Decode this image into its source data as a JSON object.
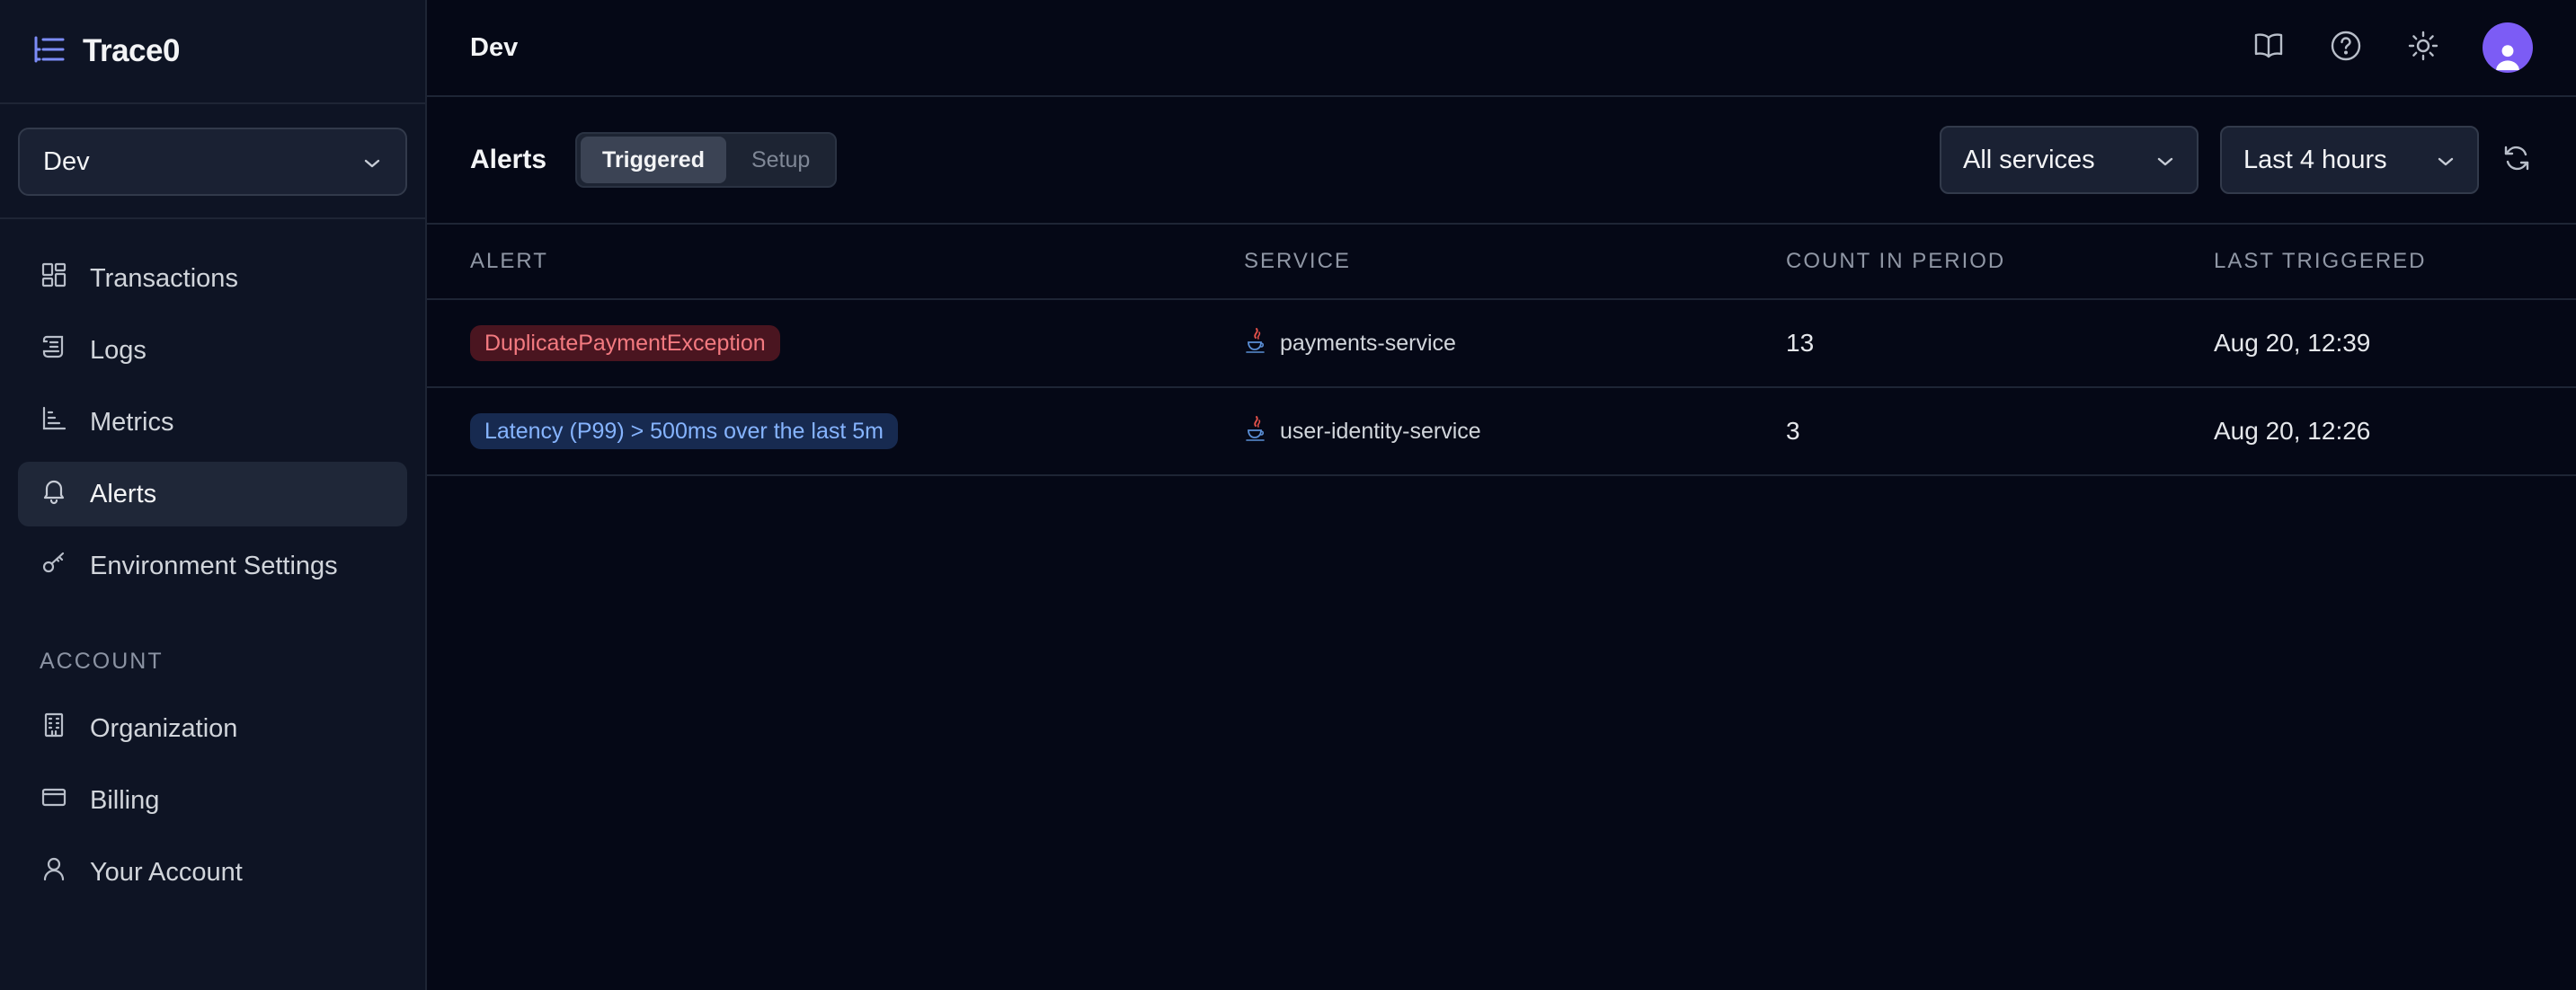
{
  "app": {
    "name": "Trace0"
  },
  "sidebar": {
    "environment": "Dev",
    "nav": [
      {
        "label": "Transactions",
        "icon": "dashboard-icon",
        "active": false
      },
      {
        "label": "Logs",
        "icon": "scroll-icon",
        "active": false
      },
      {
        "label": "Metrics",
        "icon": "bar-chart-icon",
        "active": false
      },
      {
        "label": "Alerts",
        "icon": "bell-icon",
        "active": true
      },
      {
        "label": "Environment Settings",
        "icon": "key-icon",
        "active": false
      }
    ],
    "account_section_label": "ACCOUNT",
    "account": [
      {
        "label": "Organization",
        "icon": "building-icon"
      },
      {
        "label": "Billing",
        "icon": "credit-card-icon"
      },
      {
        "label": "Your Account",
        "icon": "user-icon"
      }
    ]
  },
  "header": {
    "title": "Dev"
  },
  "toolbar": {
    "title": "Alerts",
    "tabs": [
      {
        "label": "Triggered",
        "active": true
      },
      {
        "label": "Setup",
        "active": false
      }
    ],
    "service_filter": "All services",
    "time_range": "Last 4 hours"
  },
  "table": {
    "columns": [
      "ALERT",
      "SERVICE",
      "COUNT IN PERIOD",
      "LAST TRIGGERED"
    ],
    "rows": [
      {
        "alert": "DuplicatePaymentException",
        "severity": "error",
        "service": "payments-service",
        "count": "13",
        "last_triggered": "Aug 20, 12:39"
      },
      {
        "alert": "Latency (P99) > 500ms over the last 5m",
        "severity": "info",
        "service": "user-identity-service",
        "count": "3",
        "last_triggered": "Aug 20, 12:26"
      }
    ]
  },
  "colors": {
    "background": "#050816",
    "sidebar": "#0e1424",
    "accent": "#7c5cf5",
    "error_badge_bg": "#4a1520",
    "error_badge_text": "#f37a80",
    "info_badge_bg": "#172a50",
    "info_badge_text": "#86b4ff"
  }
}
